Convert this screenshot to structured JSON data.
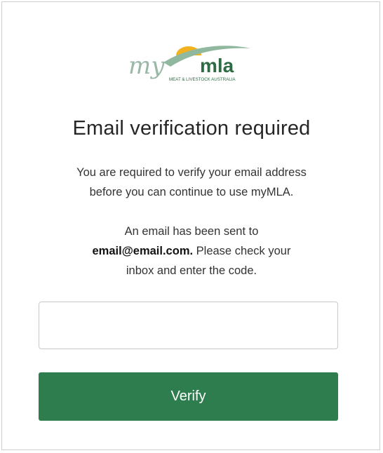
{
  "logo": {
    "my_text": "my",
    "mla_text": "mla",
    "tagline": "MEAT & LIVESTOCK AUSTRALIA",
    "colors": {
      "my": "#9ab8a8",
      "mla": "#2e6b45",
      "sun": "#f2b21f",
      "swoosh": "#8fb89f"
    }
  },
  "heading": "Email verification required",
  "message": {
    "line1": "You are required to verify your email address",
    "line2": "before you can continue to use myMLA.",
    "line3": "An email has been sent to",
    "email": "email@email.com.",
    "line4_rest": " Please check your",
    "line5": "inbox and enter the code."
  },
  "code_input": {
    "value": "",
    "placeholder": ""
  },
  "verify_button": {
    "label": "Verify",
    "color": "#2e7d4f"
  }
}
